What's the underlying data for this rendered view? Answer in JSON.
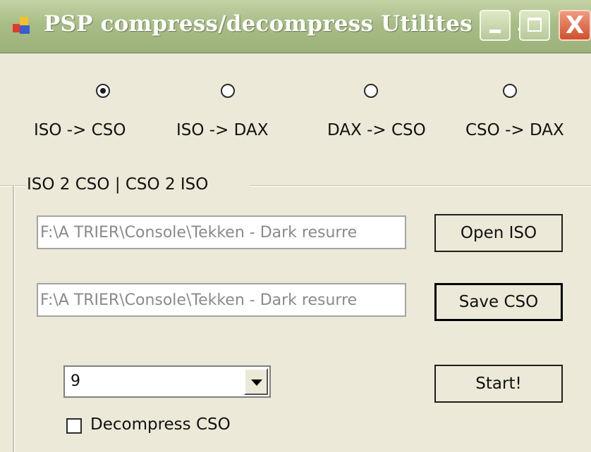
{
  "window": {
    "title": "PSP compress/decompress Utilites by ...",
    "controls": {
      "minimize": "minimize-icon",
      "maximize": "maximize-icon",
      "close": "close-icon"
    },
    "close_glyph": "X"
  },
  "modes": [
    {
      "label": "ISO -> CSO",
      "selected": true
    },
    {
      "label": "ISO -> DAX",
      "selected": false
    },
    {
      "label": "DAX -> CSO",
      "selected": false
    },
    {
      "label": "CSO -> DAX",
      "selected": false
    }
  ],
  "group": {
    "title": "ISO 2 CSO  |  CSO 2 ISO"
  },
  "input_path": "F:\\A TRIER\\Console\\Tekken - Dark resurre",
  "output_path": "F:\\A TRIER\\Console\\Tekken - Dark resurre",
  "buttons": {
    "open": "Open ISO",
    "save": "Save CSO",
    "start": "Start!"
  },
  "compression_level": "9",
  "decompress_checkbox": {
    "label": "Decompress CSO",
    "checked": false
  },
  "colors": {
    "titlebar": "#a8bd86",
    "window_bg": "#ece9d8",
    "close_button": "#d0502e"
  }
}
